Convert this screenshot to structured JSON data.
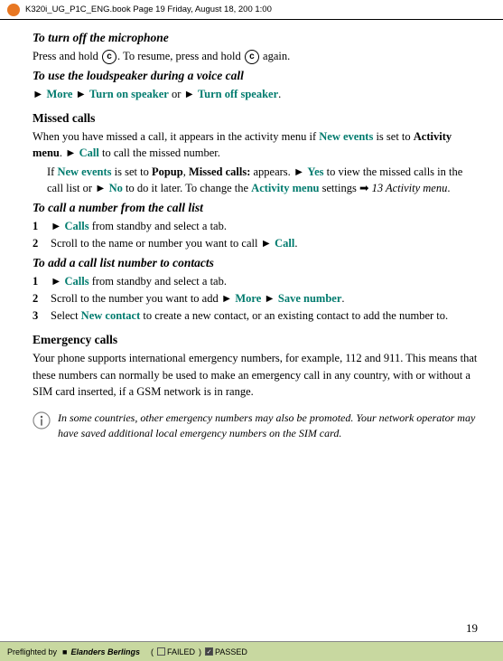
{
  "topBar": {
    "bookInfo": "K320i_UG_P1C_ENG.book  Page 19  Friday, August 18, 200   1:00 "
  },
  "content": {
    "sections": [
      {
        "id": "turn-off-mic",
        "heading": "To turn off the microphone",
        "type": "italic-bold-heading",
        "body": "Press and hold . To resume, press and hold  again."
      },
      {
        "id": "loudspeaker",
        "heading": "To use the loudspeaker during a voice call",
        "type": "italic-bold-heading",
        "menu": "More › Turn on speaker or › Turn off speaker."
      },
      {
        "id": "missed-calls",
        "heading": "Missed calls",
        "type": "bold-heading",
        "paragraphs": [
          "When you have missed a call, it appears in the activity menu if New events is set to Activity menu. › Call to call the missed number.",
          "If New events is set to Popup, Missed calls: appears. › Yes to view the missed calls in the call list or › No to do it later. To change the Activity menu settings ➡ 13 Activity menu."
        ]
      },
      {
        "id": "call-from-list",
        "heading": "To call a number from the call list",
        "type": "italic-bold-heading",
        "steps": [
          "› Calls from standby and select a tab.",
          "Scroll to the name or number you want to call › Call."
        ]
      },
      {
        "id": "add-to-contacts",
        "heading": "To add a call list number to contacts",
        "type": "italic-bold-heading",
        "steps": [
          "› Calls from standby and select a tab.",
          "Scroll to the number you want to add › More › Save number.",
          "Select New contact to create a new contact, or an existing contact to add the number to."
        ]
      },
      {
        "id": "emergency-calls",
        "heading": "Emergency calls",
        "type": "bold-heading",
        "body": "Your phone supports international emergency numbers, for example, 112 and 911. This means that these numbers can normally be used to make an emergency call in any country, with or without a SIM card inserted, if a GSM network is in range."
      }
    ],
    "tip": "In some countries, other emergency numbers may also be promoted. Your network operator may have saved additional local emergency numbers on the SIM card.",
    "pageNumber": "19"
  },
  "bottomBar": {
    "preflightedBy": "Preflighted by",
    "logo": "Elanders Berlings",
    "failedLabel": "FAILED",
    "passedLabel": "PASSED"
  }
}
